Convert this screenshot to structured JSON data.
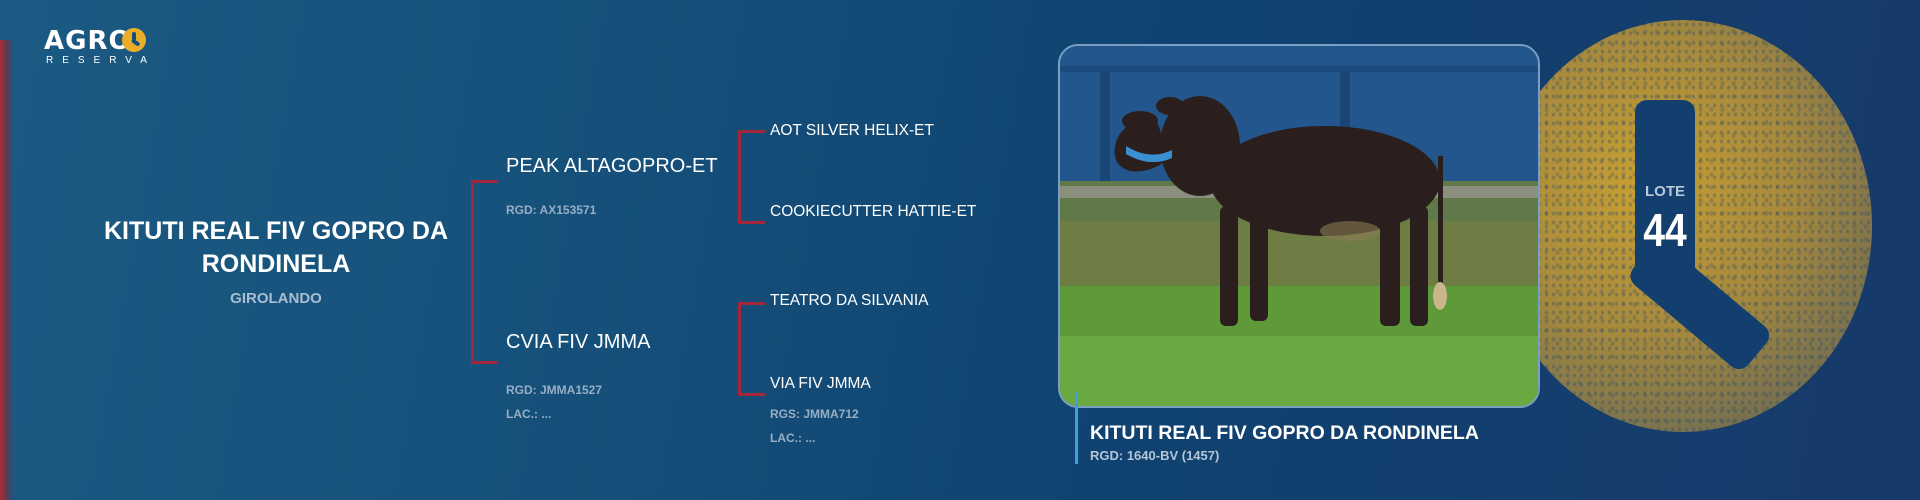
{
  "brand": {
    "logo_word": "AGRO",
    "logo_sub": "RESERVA"
  },
  "animal": {
    "name": "KITUTI REAL FIV GOPRO DA RONDINELA",
    "breed": "GIROLANDO"
  },
  "pedigree": {
    "sire": {
      "name": "PEAK ALTAGOPRO-ET",
      "rgd": "RGD: AX153571"
    },
    "dam": {
      "name": "CVIA FIV JMMA",
      "rgd": "RGD: JMMA1527",
      "lac": "LAC.: ..."
    },
    "paternal_grandsire": {
      "name": "AOT SILVER HELIX-ET"
    },
    "paternal_granddam": {
      "name": "COOKIECUTTER HATTIE-ET"
    },
    "maternal_grandsire": {
      "name": "TEATRO DA SILVANIA"
    },
    "maternal_granddam": {
      "name": "VIA FIV JMMA",
      "rgs": "RGS: JMMA712",
      "lac": "LAC.: ..."
    }
  },
  "lote": {
    "label": "LOTE",
    "number": "44"
  },
  "photo_caption": {
    "name": "KITUTI REAL FIV GOPRO DA RONDINELA",
    "rgd": "RGD: 1640-BV (1457)"
  },
  "colors": {
    "background": "#154f79",
    "bracket": "#a3263b",
    "accent_gold": "#e9ad2a",
    "caption_line": "#3fa0d8"
  }
}
